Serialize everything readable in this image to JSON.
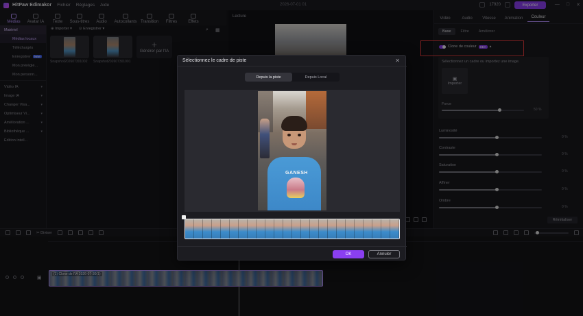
{
  "app": {
    "title": "HitPaw Edimakor",
    "menu": [
      "Fichier",
      "Réglages",
      "Aide"
    ],
    "date": "2026-07-01 01",
    "coins": "17920",
    "export_label": "Exporter",
    "window_controls": [
      "—",
      "□",
      "✕"
    ]
  },
  "media_tabs": [
    "Médias",
    "Avatar IA",
    "Texte",
    "Sous-titres",
    "Audio",
    "Autocollants",
    "Transition",
    "Filtres",
    "Effets"
  ],
  "sidebar": {
    "items": [
      {
        "label": "Matériel",
        "type": "section-active"
      },
      {
        "label": "Médias locaux",
        "type": "sub-active"
      },
      {
        "label": "Téléchargés",
        "type": "sub"
      },
      {
        "label": "Enregistrer",
        "type": "sub",
        "badge": "New"
      },
      {
        "label": "Mon préréglé...",
        "type": "sub"
      },
      {
        "label": "Mon personn...",
        "type": "sub"
      },
      {
        "label": "Vidéo IA",
        "type": "section"
      },
      {
        "label": "Image IA",
        "type": "section"
      },
      {
        "label": "Changer Visa...",
        "type": "section"
      },
      {
        "label": "Optimiseur Vi...",
        "type": "section"
      },
      {
        "label": "Amélioration ...",
        "type": "section"
      },
      {
        "label": "Bibliothèque ...",
        "type": "section"
      },
      {
        "label": "Édition intell...",
        "type": "section"
      }
    ]
  },
  "media": {
    "import_label": "Importer",
    "record_label": "Enregistrer",
    "thumbs": [
      "Snapshot202607301002",
      "Snapshot202607301001"
    ],
    "generate_label": "Générer par l'IA"
  },
  "preview": {
    "label": "Lecture"
  },
  "right_panel": {
    "tabs": [
      "Vidéo",
      "Audio",
      "Vitesse",
      "Animation",
      "Couleur"
    ],
    "subtabs": [
      "Base",
      "Filtre",
      "Améliorer"
    ],
    "clone_label": "Clone de couleur",
    "clone_badge": "SEA",
    "clone_desc": "Sélectionnez un cadre ou importez une image.",
    "import_label": "Importer",
    "force_label": "Force",
    "force_value": "50",
    "force_unit": "%",
    "params": [
      {
        "label": "Luminosité",
        "value": "0",
        "unit": "%"
      },
      {
        "label": "Contraste",
        "value": "0",
        "unit": "%"
      },
      {
        "label": "Saturation",
        "value": "0",
        "unit": "%"
      },
      {
        "label": "Affiner",
        "value": "0",
        "unit": "%"
      },
      {
        "label": "Ombre",
        "value": "0",
        "unit": "%"
      }
    ],
    "reset_label": "Réinitialiser"
  },
  "timeline": {
    "divide_label": "Diviser",
    "clip_label": "(1) Clone de l'IA 2026-07-30(1)"
  },
  "modal": {
    "title": "Sélectionnez le cadre de piste",
    "close": "✕",
    "tabs": [
      "Depuis la piste",
      "Depuis Local"
    ],
    "shirt_text": "GANESH",
    "ok_label": "OK",
    "cancel_label": "Annuler"
  },
  "colors": {
    "accent": "#8a3ff0",
    "highlight": "#e03b3b"
  }
}
